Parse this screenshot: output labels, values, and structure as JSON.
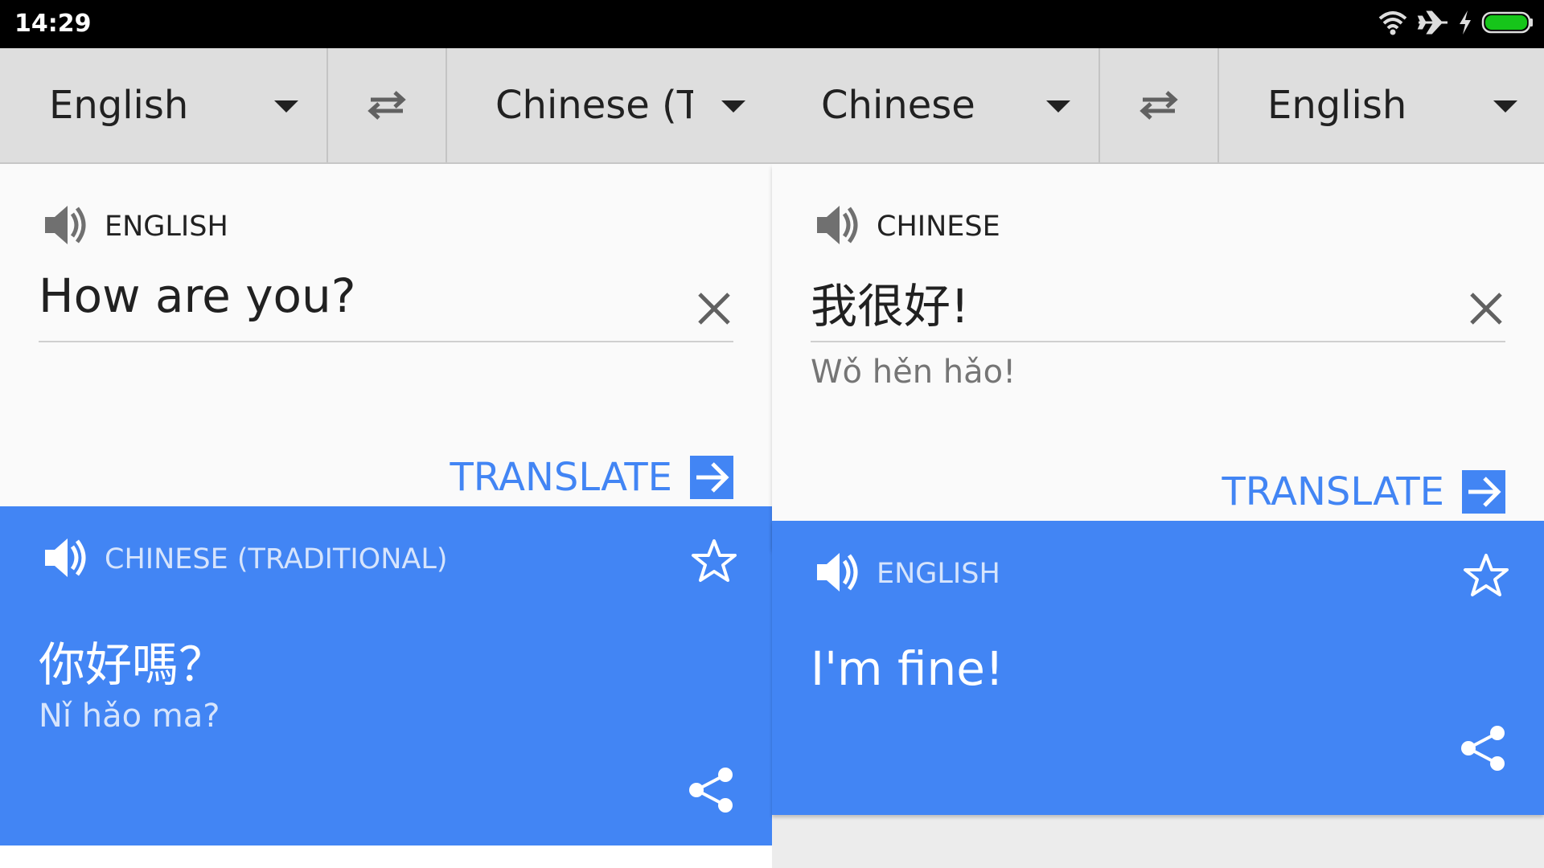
{
  "status_bar": {
    "time": "14:29",
    "icons": [
      "wifi-icon",
      "airplane-icon",
      "charging-icon",
      "battery-icon"
    ]
  },
  "colors": {
    "accent": "#4285f4",
    "langbar": "#dedede",
    "card": "#fafafa",
    "result_text": "#ffffff"
  },
  "left_pane": {
    "source_language": "English",
    "target_language": "Chinese (Tr",
    "input_card": {
      "language_label": "ENGLISH",
      "text": "How are you?",
      "translate_label": "TRANSLATE"
    },
    "result_card": {
      "language_label": "CHINESE (TRADITIONAL)",
      "text": "你好嗎？",
      "transliteration": "Nǐ hǎo ma?"
    }
  },
  "right_pane": {
    "source_language": "Chinese",
    "target_language": "English",
    "input_card": {
      "language_label": "CHINESE",
      "text": "我很好!",
      "transliteration": "Wǒ hěn hǎo!",
      "translate_label": "TRANSLATE"
    },
    "result_card": {
      "language_label": "ENGLISH",
      "text": "I'm fine!"
    }
  }
}
